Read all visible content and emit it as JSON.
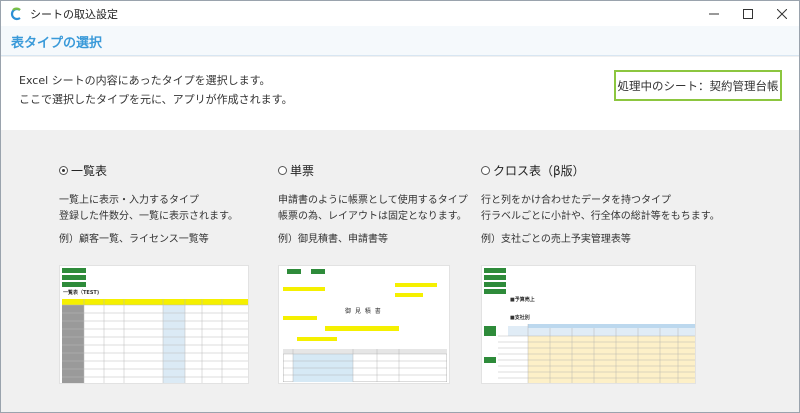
{
  "window": {
    "title": "シートの取込設定",
    "min_icon": "minimize-icon",
    "max_icon": "maximize-icon",
    "close_icon": "close-icon",
    "app_icon": "app-logo-icon"
  },
  "section": {
    "title": "表タイプの選択"
  },
  "description": {
    "line1": "Excel シートの内容にあったタイプを選択します。",
    "line2": "ここで選択したタイプを元に、アプリが作成されます。"
  },
  "current_sheet": {
    "label": "処理中のシート：契約管理台帳"
  },
  "options": [
    {
      "label": "一覧表",
      "selected": true,
      "line1": "一覧上に表示・入力するタイプ",
      "line2": "登録した件数分、一覧に表示されます。",
      "example": "例）顧客一覧、ライセンス一覧等"
    },
    {
      "label": "単票",
      "selected": false,
      "line1": "申請書のように帳票として使用するタイプ",
      "line2": "帳票の為、レイアウトは固定となります。",
      "example": "例）御見積書、申請書等"
    },
    {
      "label": "クロス表（β版）",
      "selected": false,
      "line1": "行と列をかけ合わせたデータを持つタイプ",
      "line2": "行ラベルごとに小計や、行全体の総計等をもちます。",
      "example": "例）支社ごとの売上予実管理表等"
    }
  ],
  "previews": {
    "list_title": "一覧表（TEST)",
    "form_title": "御 見 積 書",
    "cross_title": "■予算売上",
    "cross_sub": "■支社別"
  },
  "colors": {
    "accent_blue": "#3a9ad9",
    "sheet_border": "#8cc63f",
    "preview_green": "#2e8b3a",
    "preview_yellow": "#f5f000"
  }
}
